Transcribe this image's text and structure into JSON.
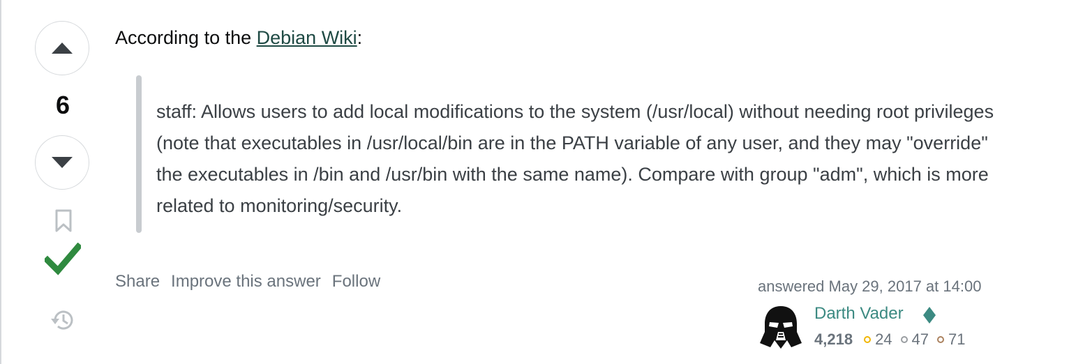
{
  "vote": {
    "count": "6"
  },
  "post": {
    "intro_prefix": "According to the ",
    "link_text": "Debian Wiki",
    "intro_suffix": ":",
    "blockquote": "staff: Allows users to add local modifications to the system (/usr/local) without needing root privileges (note that executables in /usr/local/bin are in the PATH variable of any user, and they may \"override\" the executables in /bin and /usr/bin with the same name). Compare with group \"adm\", which is more related to monitoring/security."
  },
  "menu": {
    "share": "Share",
    "improve": "Improve this answer",
    "follow": "Follow"
  },
  "user": {
    "action_time": "answered May 29, 2017 at 14:00",
    "name": "Darth Vader",
    "reputation": "4,218",
    "gold": "24",
    "silver": "47",
    "bronze": "71"
  },
  "colors": {
    "accepted": "#2f8a3f",
    "link": "#1f4a44",
    "username": "#3c8a82",
    "gold": "#f1b600",
    "silver": "#9a9ea2",
    "bronze": "#ab825f"
  }
}
